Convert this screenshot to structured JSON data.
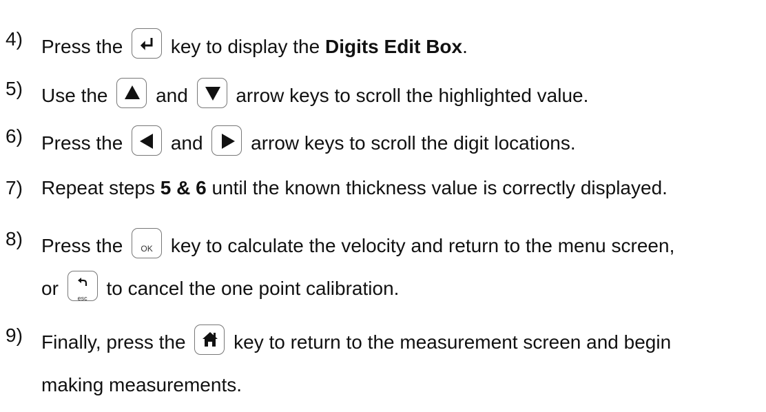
{
  "steps": [
    {
      "num": "4)",
      "a": "Press the",
      "b": "key to display the",
      "bold": "Digits Edit Box",
      "c": ".",
      "keys": [
        "enter-icon"
      ]
    },
    {
      "num": "5)",
      "a": "Use the",
      "mid": "and",
      "b": "arrow keys to scroll the highlighted value.",
      "keys": [
        "up-arrow-icon",
        "down-arrow-icon"
      ]
    },
    {
      "num": "6)",
      "a": "Press the",
      "mid": "and",
      "b": "arrow keys to scroll the digit locations.",
      "keys": [
        "left-arrow-icon",
        "right-arrow-icon"
      ]
    },
    {
      "num": "7)",
      "a": "Repeat steps",
      "bold": "5 & 6",
      "b": "until the known thickness value is correctly displayed."
    },
    {
      "num": "8)",
      "a": "Press the",
      "b": "key to calculate the velocity and return to the menu screen,",
      "a2": "or",
      "b2": "to cancel the one point calibration.",
      "key_ok_label": "OK",
      "key_esc_label": "esc"
    },
    {
      "num": "9)",
      "a": "Finally, press the",
      "b": "key to return to the measurement screen and begin",
      "b2": "making measurements.",
      "keys": [
        "home-icon"
      ]
    }
  ]
}
